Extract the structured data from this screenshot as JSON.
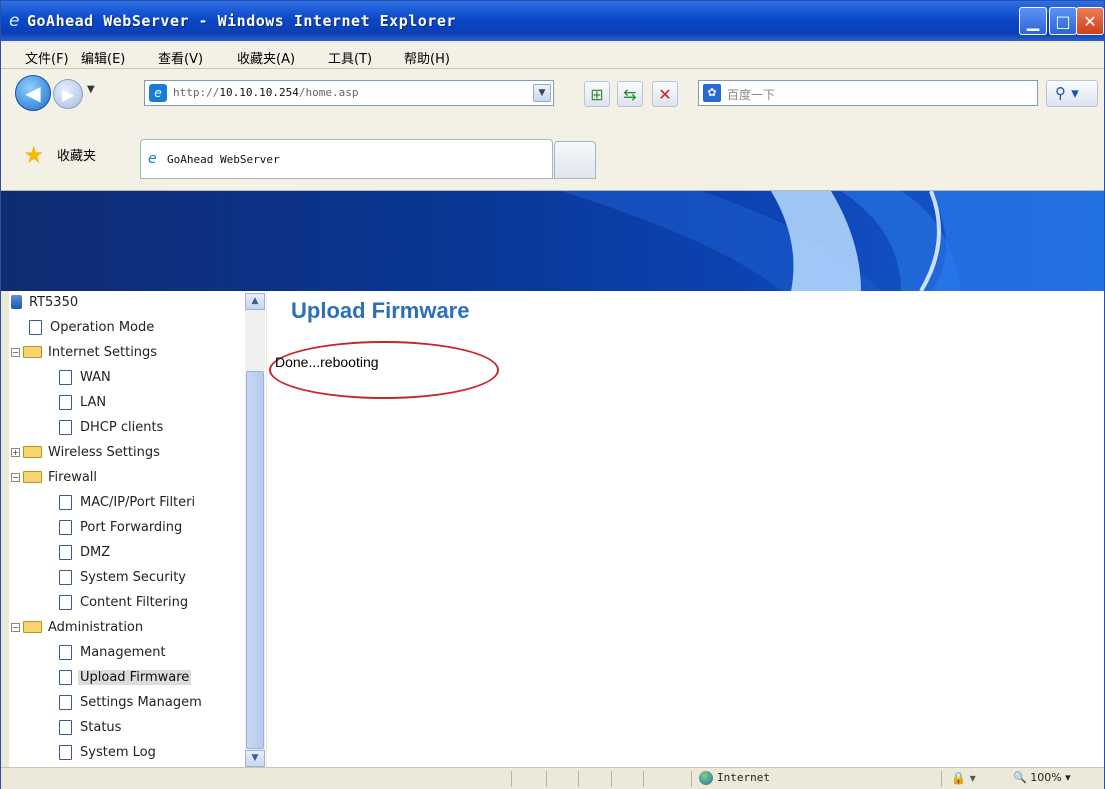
{
  "window": {
    "title": "GoAhead WebServer - Windows Internet Explorer",
    "buttons": {
      "min": "▁",
      "max": "□",
      "close": "✕"
    }
  },
  "menubar": {
    "items": [
      "文件(F)",
      "编辑(E)",
      "查看(V)",
      "收藏夹(A)",
      "工具(T)",
      "帮助(H)"
    ]
  },
  "navbar": {
    "address_prefix": "http://",
    "address_host": "10.10.10.254",
    "address_path": "/home.asp",
    "search_placeholder": "百度一下"
  },
  "favorites": {
    "label": "收藏夹",
    "tab_title": "GoAhead WebServer"
  },
  "sidebar": {
    "root": "RT5350",
    "items": [
      "Operation Mode",
      "Internet Settings",
      "WAN",
      "LAN",
      "DHCP clients",
      "Wireless Settings",
      "Firewall",
      "MAC/IP/Port Filteri",
      "Port Forwarding",
      "DMZ",
      "System Security",
      "Content Filtering",
      "Administration",
      "Management",
      "Upload Firmware",
      "Settings Managem",
      "Status",
      "System Log"
    ],
    "selected": "Upload Firmware"
  },
  "main": {
    "title": "Upload Firmware",
    "status": "Done...rebooting"
  },
  "statusbar": {
    "zone": "Internet",
    "zoom": "100%"
  },
  "colors": {
    "title_blue": "#2d6fb8",
    "highlight_red": "#c22a2a",
    "banner": "#0a3694"
  },
  "icons": [
    "ie-icon",
    "back-icon",
    "forward-icon",
    "refresh-icon",
    "stop-icon",
    "search-icon",
    "star-icon",
    "folder-icon",
    "document-icon",
    "globe-icon"
  ]
}
